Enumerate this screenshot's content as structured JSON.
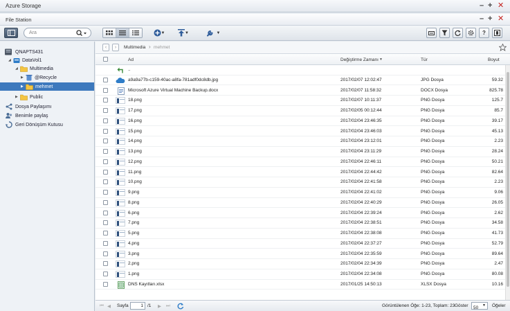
{
  "window": {
    "outer_title": "Azure Storage",
    "inner_title": "File Station"
  },
  "toolbar": {
    "search_placeholder": "Ara"
  },
  "sidebar": {
    "root": "QNAPTS431",
    "volume": "DataVol1",
    "folder": "Multimedia",
    "recycle": "@Recycle",
    "selected": "mehmet",
    "public": "Public",
    "share": "Dosya Paylaşımı",
    "shared_with_me": "Benimle paylaş",
    "recycle_bin": "Geri Dönüşüm Kutusu"
  },
  "breadcrumb": {
    "parent": "Multimedia",
    "current": "mehmet"
  },
  "columns": {
    "name": "Ad",
    "modified": "Değiştirme Zamanı",
    "type": "Tür",
    "size": "Boyut"
  },
  "files": [
    {
      "name": "..",
      "modified": "",
      "type": "",
      "size": "",
      "icon": "up-arrow"
    },
    {
      "name": "a9a9a77b-c159-40ac-a8fa-781adf0dc8db.jpg",
      "modified": "2017/02/07 12:02:47",
      "type": "JPG Dosya",
      "size": "59.32",
      "icon": "cloud"
    },
    {
      "name": "Microsoft Azure Virtual Machine Backup.docx",
      "modified": "2017/02/07 11:58:32",
      "type": "DOCX Dosya",
      "size": "825.78",
      "icon": "doc"
    },
    {
      "name": "18.png",
      "modified": "2017/02/07 10:11:37",
      "type": "PNG Dosya",
      "size": "125.7",
      "icon": "thumb"
    },
    {
      "name": "17.png",
      "modified": "2017/02/05 00:12:44",
      "type": "PNG Dosya",
      "size": "85.7",
      "icon": "thumb"
    },
    {
      "name": "16.png",
      "modified": "2017/02/04 23:46:35",
      "type": "PNG Dosya",
      "size": "39.17",
      "icon": "thumb"
    },
    {
      "name": "15.png",
      "modified": "2017/02/04 23:46:03",
      "type": "PNG Dosya",
      "size": "45.13",
      "icon": "thumb"
    },
    {
      "name": "14.png",
      "modified": "2017/02/04 23:12:01",
      "type": "PNG Dosya",
      "size": "2.23",
      "icon": "thumb"
    },
    {
      "name": "13.png",
      "modified": "2017/02/04 23:11:29",
      "type": "PNG Dosya",
      "size": "28.24",
      "icon": "thumb"
    },
    {
      "name": "12.png",
      "modified": "2017/02/04 22:46:11",
      "type": "PNG Dosya",
      "size": "50.21",
      "icon": "thumb"
    },
    {
      "name": "11.png",
      "modified": "2017/02/04 22:44:42",
      "type": "PNG Dosya",
      "size": "82.64",
      "icon": "thumb"
    },
    {
      "name": "10.png",
      "modified": "2017/02/04 22:41:58",
      "type": "PNG Dosya",
      "size": "2.23",
      "icon": "thumb"
    },
    {
      "name": "9.png",
      "modified": "2017/02/04 22:41:02",
      "type": "PNG Dosya",
      "size": "9.06",
      "icon": "thumb"
    },
    {
      "name": "8.png",
      "modified": "2017/02/04 22:40:29",
      "type": "PNG Dosya",
      "size": "26.05",
      "icon": "thumb"
    },
    {
      "name": "6.png",
      "modified": "2017/02/04 22:39:24",
      "type": "PNG Dosya",
      "size": "2.62",
      "icon": "thumb"
    },
    {
      "name": "7.png",
      "modified": "2017/02/04 22:38:51",
      "type": "PNG Dosya",
      "size": "34.58",
      "icon": "thumb"
    },
    {
      "name": "5.png",
      "modified": "2017/02/04 22:38:08",
      "type": "PNG Dosya",
      "size": "41.73",
      "icon": "thumb"
    },
    {
      "name": "4.png",
      "modified": "2017/02/04 22:37:27",
      "type": "PNG Dosya",
      "size": "52.79",
      "icon": "thumb"
    },
    {
      "name": "3.png",
      "modified": "2017/02/04 22:35:59",
      "type": "PNG Dosya",
      "size": "89.64",
      "icon": "thumb"
    },
    {
      "name": "2.png",
      "modified": "2017/02/04 22:34:39",
      "type": "PNG Dosya",
      "size": "2.47",
      "icon": "thumb"
    },
    {
      "name": "1.png",
      "modified": "2017/02/04 22:34:08",
      "type": "PNG Dosya",
      "size": "80.08",
      "icon": "thumb"
    },
    {
      "name": "DNS Kayıtları.xlsx",
      "modified": "2017/01/25 14:50:13",
      "type": "XLSX Dosya",
      "size": "10.16",
      "icon": "xls"
    }
  ],
  "pager": {
    "page_label": "Sayfa",
    "page_value": "1",
    "page_total": "/1",
    "summary": "Görüntülenen Öğe: 1-23, Toplam: 23",
    "show_label": "Göster",
    "show_value": "50",
    "items_label": "Öğeler"
  },
  "colors": {
    "selected": "#3d79bd",
    "close": "#c4221e"
  }
}
